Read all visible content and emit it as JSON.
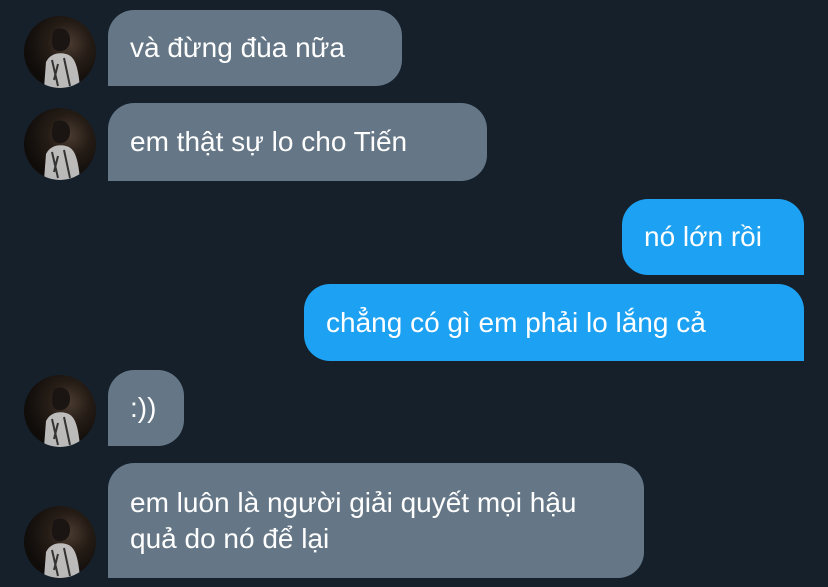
{
  "conversation": {
    "messages": [
      {
        "sender": "other",
        "text": "và đừng đùa nữa"
      },
      {
        "sender": "other",
        "text": "em thật sự lo cho Tiến"
      },
      {
        "sender": "me",
        "text": "nó lớn rồi"
      },
      {
        "sender": "me",
        "text": "chẳng có gì em phải lo lắng cả"
      },
      {
        "sender": "other",
        "text": ":))"
      },
      {
        "sender": "other",
        "text": "em luôn là người giải quyết mọi hậu quả do nó để lại"
      }
    ]
  },
  "colors": {
    "background": "#15202b",
    "incoming_bubble": "#657786",
    "outgoing_bubble": "#1da1f2",
    "text": "#ffffff"
  }
}
